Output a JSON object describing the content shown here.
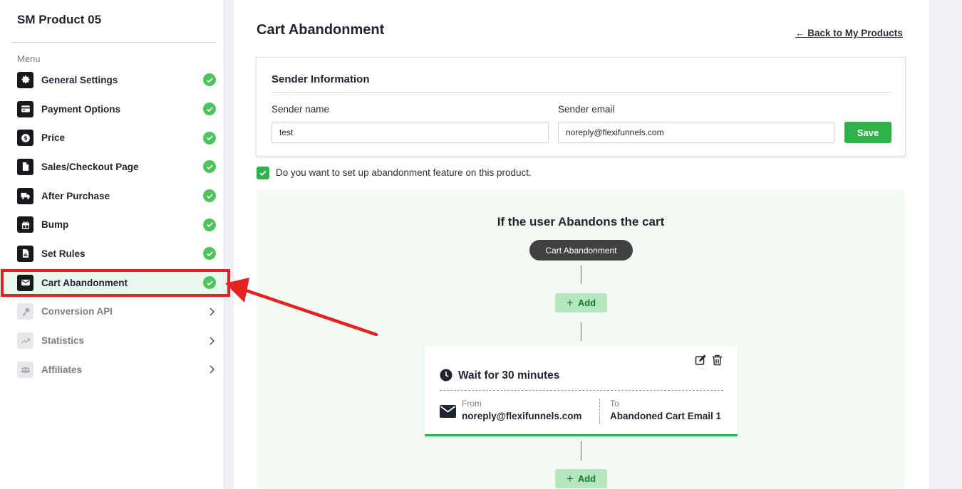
{
  "colors": {
    "accent_green": "#2fb24a",
    "check_green": "#4fc35e",
    "annotation_red": "#e32222"
  },
  "sidebar": {
    "product_title": "SM Product 05",
    "menu_label": "Menu",
    "items": [
      {
        "label": "General Settings",
        "icon": "gear-icon",
        "status": "complete"
      },
      {
        "label": "Payment Options",
        "icon": "credit-card-icon",
        "status": "complete"
      },
      {
        "label": "Price",
        "icon": "dollar-icon",
        "status": "complete"
      },
      {
        "label": "Sales/Checkout Page",
        "icon": "document-icon",
        "status": "complete"
      },
      {
        "label": "After Purchase",
        "icon": "truck-icon",
        "status": "complete"
      },
      {
        "label": "Bump",
        "icon": "gift-icon",
        "status": "complete"
      },
      {
        "label": "Set Rules",
        "icon": "file-chart-icon",
        "status": "complete"
      },
      {
        "label": "Cart Abandonment",
        "icon": "envelope-icon",
        "status": "complete",
        "active": true
      },
      {
        "label": "Conversion API",
        "icon": "key-icon",
        "status": "locked"
      },
      {
        "label": "Statistics",
        "icon": "trend-icon",
        "status": "locked"
      },
      {
        "label": "Affiliates",
        "icon": "users-icon",
        "status": "locked"
      }
    ]
  },
  "main": {
    "title": "Cart Abandonment",
    "back_link": "Back to My Products",
    "sender": {
      "title": "Sender Information",
      "name_label": "Sender name",
      "name_value": "test",
      "email_label": "Sender email",
      "email_value": "noreply@flexifunnels.com",
      "save_label": "Save"
    },
    "feature_checkbox": {
      "checked": true,
      "text": "Do you want to set up abandonment feature on this product."
    },
    "flow": {
      "title": "If the user Abandons the cart",
      "trigger_label": "Cart Abandonment",
      "add_label": "Add",
      "step": {
        "title": "Wait for 30 minutes",
        "from_label": "From",
        "from_value": "noreply@flexifunnels.com",
        "to_label": "To",
        "to_value": "Abandoned Cart Email 1"
      }
    }
  }
}
